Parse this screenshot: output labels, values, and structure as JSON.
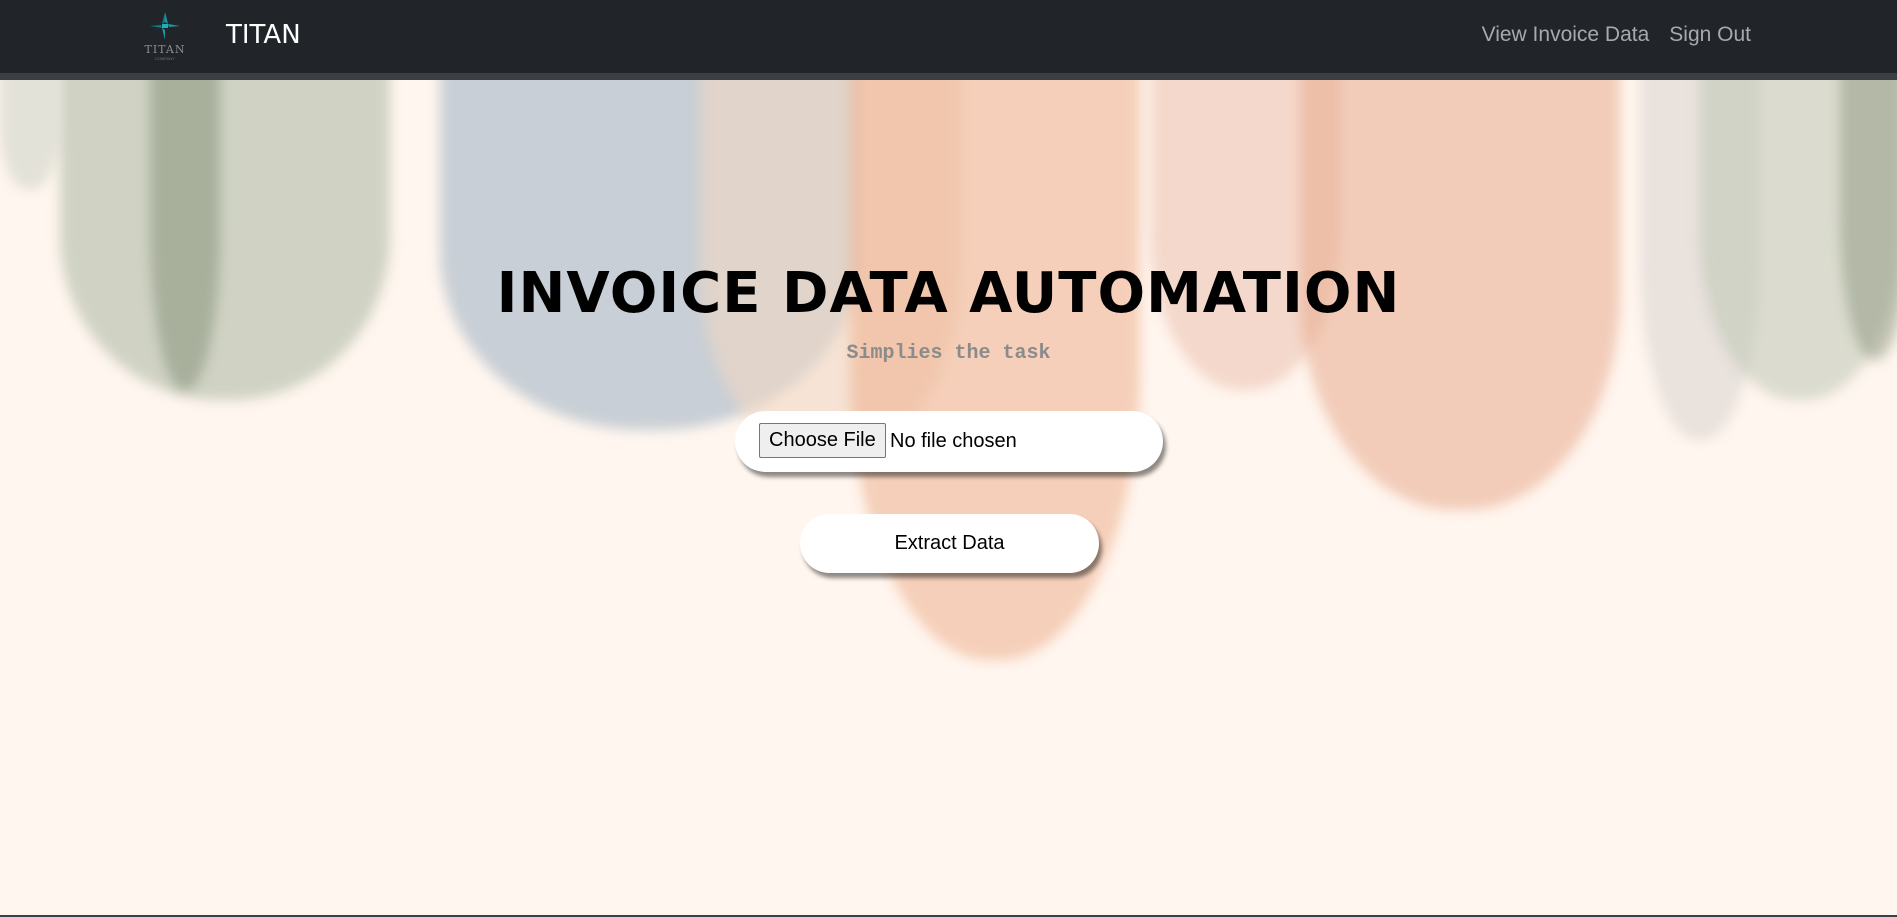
{
  "navbar": {
    "logo_text": "TITAN",
    "logo_subtext": "COMPANY",
    "brand_name": "TITAN",
    "links": [
      {
        "label": "View Invoice Data"
      },
      {
        "label": "Sign Out"
      }
    ]
  },
  "hero": {
    "title": "INVOICE DATA AUTOMATION",
    "subtitle": "Simplies the task"
  },
  "upload": {
    "choose_file_label": "Choose File",
    "file_status": "No file chosen"
  },
  "actions": {
    "extract_label": "Extract Data"
  },
  "colors": {
    "navbar_bg": "#212529",
    "page_bg": "#fff6ef",
    "nav_link": "#a5aaae",
    "logo_accent": "#1a9aa0"
  }
}
